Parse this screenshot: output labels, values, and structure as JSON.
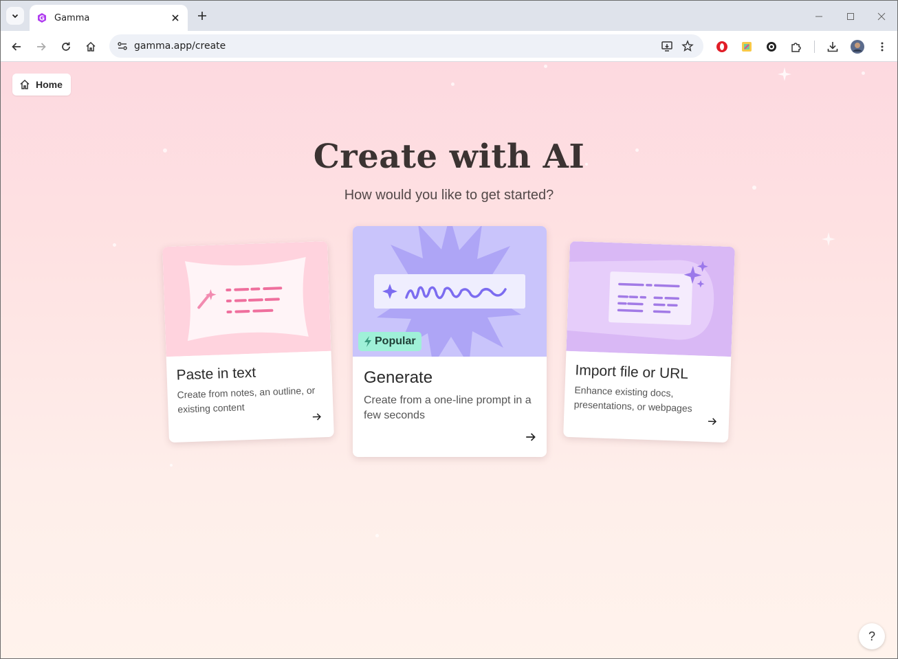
{
  "browser": {
    "tab_title": "Gamma",
    "url": "gamma.app/create"
  },
  "page": {
    "home_label": "Home",
    "headline": "Create with AI",
    "subheadline": "How would you like to get started?",
    "cards": [
      {
        "title": "Paste in text",
        "description": "Create from notes, an outline, or existing content"
      },
      {
        "title": "Generate",
        "description": "Create from a one-line prompt in a few seconds",
        "badge": "Popular"
      },
      {
        "title": "Import file or URL",
        "description": "Enhance existing docs, presentations, or webpages"
      }
    ],
    "help_label": "?"
  },
  "colors": {
    "accent_purple": "#7c6cf0",
    "badge_bg": "#9ff0d8",
    "card1_art": "#ffd3de",
    "card2_art": "#c9c4fb",
    "card3_art": "#d9b8f5"
  }
}
